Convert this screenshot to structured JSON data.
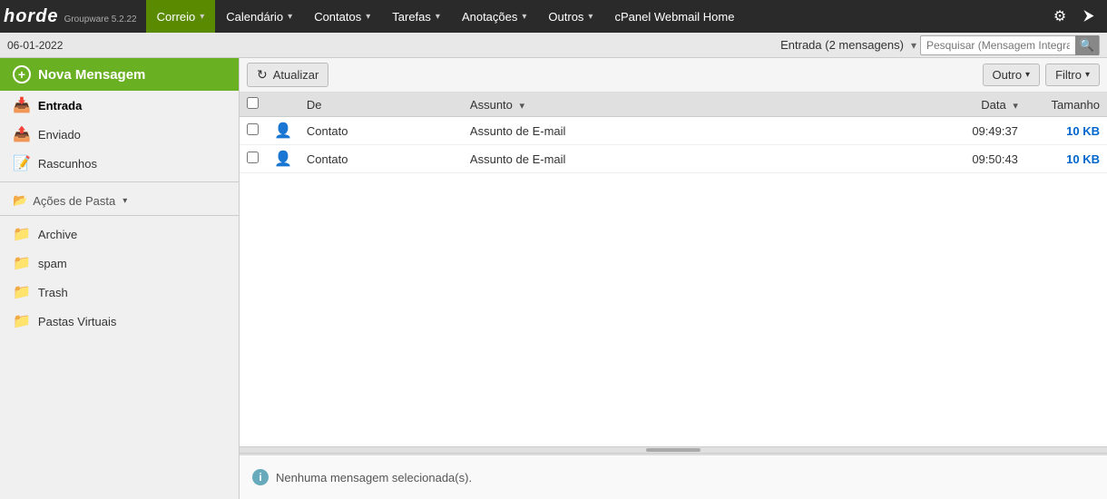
{
  "app": {
    "name": "horde",
    "subtitle": "Groupware 5.2.22"
  },
  "nav": {
    "items": [
      {
        "label": "Correio",
        "active": true,
        "has_arrow": true
      },
      {
        "label": "Calendário",
        "active": false,
        "has_arrow": true
      },
      {
        "label": "Contatos",
        "active": false,
        "has_arrow": true
      },
      {
        "label": "Tarefas",
        "active": false,
        "has_arrow": true
      },
      {
        "label": "Anotações",
        "active": false,
        "has_arrow": true
      },
      {
        "label": "Outros",
        "active": false,
        "has_arrow": true
      },
      {
        "label": "cPanel Webmail Home",
        "active": false,
        "has_arrow": false
      }
    ]
  },
  "datebar": {
    "date": "06-01-2022",
    "inbox_label": "Entrada (2 mensagens)",
    "search_placeholder": "Pesquisar (Mensagem Integral)"
  },
  "sidebar": {
    "new_message_label": "Nova Mensagem",
    "items": [
      {
        "label": "Entrada",
        "icon": "inbox",
        "active": true
      },
      {
        "label": "Enviado",
        "icon": "sent",
        "active": false
      },
      {
        "label": "Rascunhos",
        "icon": "drafts",
        "active": false
      }
    ],
    "folder_actions_label": "Ações de Pasta",
    "extra_folders": [
      {
        "label": "Archive",
        "icon": "folder"
      },
      {
        "label": "spam",
        "icon": "folder"
      },
      {
        "label": "Trash",
        "icon": "folder"
      },
      {
        "label": "Pastas Virtuais",
        "icon": "folder-virtual"
      }
    ]
  },
  "toolbar": {
    "refresh_label": "Atualizar",
    "other_label": "Outro",
    "filter_label": "Filtro"
  },
  "table": {
    "columns": [
      {
        "label": "",
        "key": "check"
      },
      {
        "label": "",
        "key": "avatar"
      },
      {
        "label": "De",
        "key": "from"
      },
      {
        "label": "Assunto",
        "key": "subject",
        "sortable": true
      },
      {
        "label": "Data",
        "key": "date",
        "sortable": true
      },
      {
        "label": "Tamanho",
        "key": "size"
      }
    ],
    "rows": [
      {
        "from": "Contato",
        "subject": "Assunto de E-mail",
        "date": "09:49:37",
        "size": "10 KB"
      },
      {
        "from": "Contato",
        "subject": "Assunto de E-mail",
        "date": "09:50:43",
        "size": "10 KB"
      }
    ]
  },
  "bottom_panel": {
    "message": "Nenhuma mensagem selecionada(s)."
  }
}
